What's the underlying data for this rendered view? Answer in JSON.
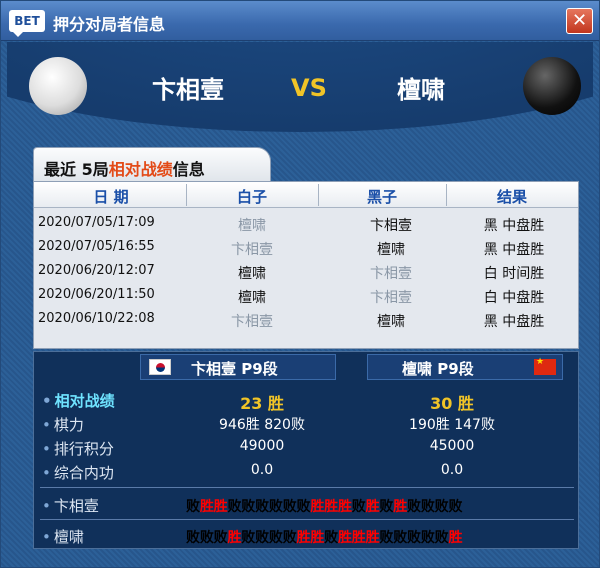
{
  "window": {
    "logo": "BET",
    "title": "押分对局者信息",
    "close_label": "✕"
  },
  "header": {
    "white_player": "卞相壹",
    "vs": "VS",
    "black_player": "檀啸"
  },
  "tab": {
    "prefix": "最近  5局",
    "highlight": "相对战绩",
    "suffix": "信息"
  },
  "table": {
    "headers": [
      "日 期",
      "白子",
      "黑子",
      "结果"
    ],
    "rows": [
      {
        "date": "2020/07/05/17:09",
        "white": "檀啸",
        "black": "卞相壹",
        "result": "黑 中盘胜",
        "winner": "black"
      },
      {
        "date": "2020/07/05/16:55",
        "white": "卞相壹",
        "black": "檀啸",
        "result": "黑 中盘胜",
        "winner": "black"
      },
      {
        "date": "2020/06/20/12:07",
        "white": "檀啸",
        "black": "卞相壹",
        "result": "白 时间胜",
        "winner": "white"
      },
      {
        "date": "2020/06/20/11:50",
        "white": "檀啸",
        "black": "卞相壹",
        "result": "白 中盘胜",
        "winner": "white"
      },
      {
        "date": "2020/06/10/22:08",
        "white": "卞相壹",
        "black": "檀啸",
        "result": "黑 中盘胜",
        "winner": "black"
      }
    ]
  },
  "stats": {
    "left_player": "卞相壹  P9段",
    "right_player": "檀啸  P9段",
    "labels": {
      "record": "相对战绩",
      "strength": "棋力",
      "ranking": "排行积分",
      "inner": "综合内功"
    },
    "record_left": "23 胜",
    "record_right": "30 胜",
    "strength_left": "946胜 820败",
    "strength_right": "190胜 147败",
    "ranking_left": "49000",
    "ranking_right": "45000",
    "inner_left": "0.0",
    "inner_right": "0.0",
    "recent": [
      {
        "name": "卞相壹",
        "results": [
          "败",
          "胜",
          "胜",
          "败",
          "败",
          "败",
          "败",
          "败",
          "败",
          "胜",
          "胜",
          "胜",
          "败",
          "胜",
          "败",
          "胜",
          "败",
          "败",
          "败",
          "败"
        ]
      },
      {
        "name": "檀啸",
        "results": [
          "败",
          "败",
          "败",
          "胜",
          "败",
          "败",
          "败",
          "败",
          "胜",
          "胜",
          "败",
          "胜",
          "胜",
          "胜",
          "败",
          "败",
          "败",
          "败",
          "败",
          "胜"
        ]
      }
    ]
  },
  "colors": {
    "win": "#ff0000",
    "loss": "#000000",
    "gold": "#f1c427",
    "tab_highlight": "#e34a17"
  }
}
